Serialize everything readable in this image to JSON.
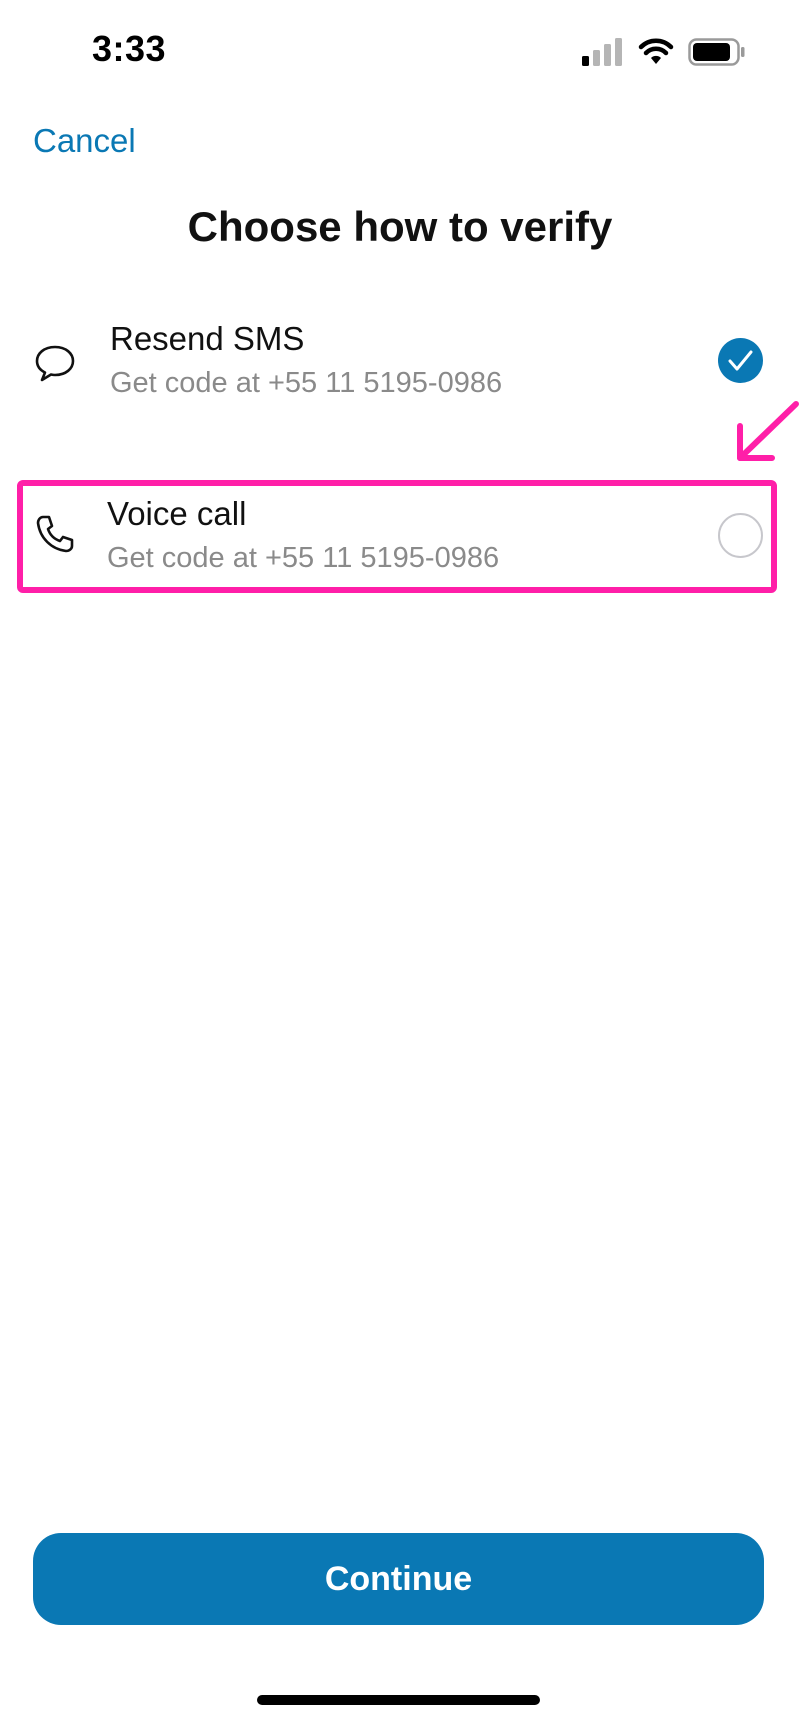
{
  "status_bar": {
    "time": "3:33",
    "icons": [
      "cellular-signal-icon",
      "wifi-icon",
      "battery-icon"
    ]
  },
  "nav": {
    "cancel_label": "Cancel"
  },
  "title": "Choose how to verify",
  "options": [
    {
      "icon": "chat-bubble-icon",
      "label": "Resend SMS",
      "subtitle": "Get code at +55 11 5195-0986",
      "selected": true
    },
    {
      "icon": "phone-icon",
      "label": "Voice call",
      "subtitle": "Get code at +55 11 5195-0986",
      "selected": false
    }
  ],
  "annotation": {
    "color": "#ff1fa8",
    "highlighted_option": "Voice call"
  },
  "continue_label": "Continue",
  "colors": {
    "accent": "#0a78b4",
    "secondary_text": "#8a8a8a",
    "annotation": "#ff1fa8"
  }
}
